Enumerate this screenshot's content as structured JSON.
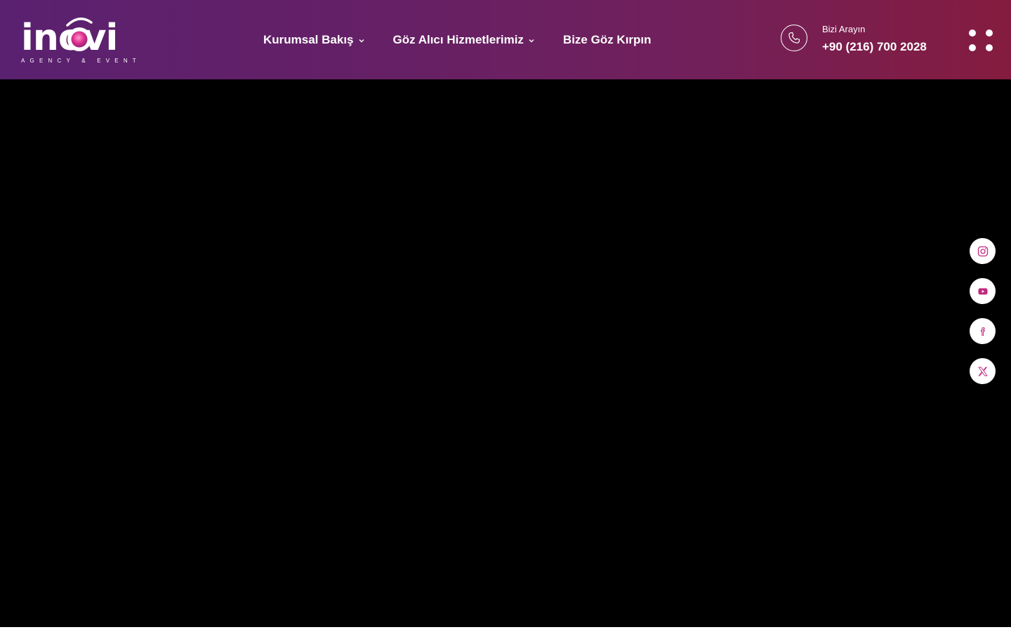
{
  "brand": {
    "name": "inovi",
    "tagline": "AGENCY & EVENT",
    "colors": {
      "header_start": "#5a2170",
      "header_end": "#851c3e",
      "accent": "#c2287f"
    }
  },
  "nav": {
    "items": [
      {
        "label": "Kurumsal Bakış",
        "has_dropdown": true
      },
      {
        "label": "Göz Alıcı Hizmetlerimiz",
        "has_dropdown": true
      },
      {
        "label": "Bize Göz Kırpın",
        "has_dropdown": false
      }
    ]
  },
  "call": {
    "label": "Bizi Arayın",
    "number": "+90 (216) 700 2028",
    "icon": "phone-icon"
  },
  "menu": {
    "icon": "menu-dots-icon"
  },
  "hero": {
    "background": "#000000"
  },
  "socials": [
    {
      "name": "instagram",
      "icon": "instagram-icon"
    },
    {
      "name": "youtube",
      "icon": "youtube-icon"
    },
    {
      "name": "facebook",
      "icon": "facebook-icon"
    },
    {
      "name": "x",
      "icon": "x-icon"
    }
  ]
}
